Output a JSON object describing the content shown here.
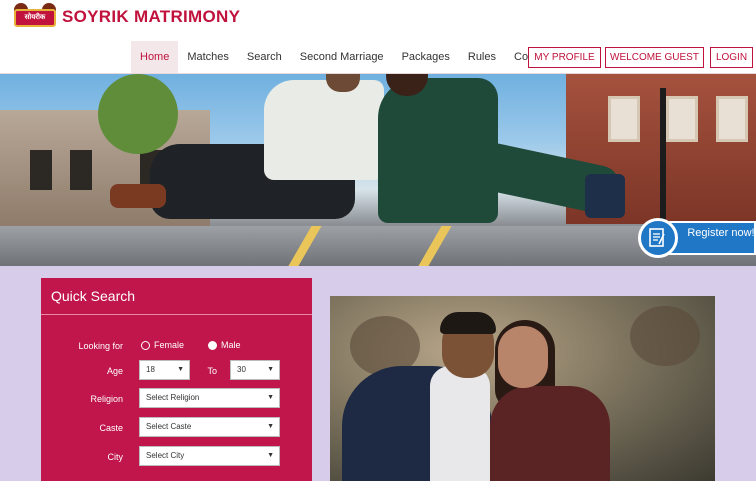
{
  "brand": {
    "name": "SOYRIK MATRIMONY",
    "emblem_text": "सोयरीक"
  },
  "nav": {
    "items": [
      {
        "label": "Home",
        "active": true
      },
      {
        "label": "Matches"
      },
      {
        "label": "Search"
      },
      {
        "label": "Second Marriage"
      },
      {
        "label": "Packages"
      },
      {
        "label": "Rules"
      },
      {
        "label": "Contact"
      }
    ],
    "my_profile": "MY PROFILE",
    "welcome": "WELCOME GUEST",
    "login": "LOGIN"
  },
  "banner": {
    "register_label": "Register now!"
  },
  "quick_search": {
    "title": "Quick Search",
    "looking_for_label": "Looking for",
    "female_label": "Female",
    "male_label": "Male",
    "selected_gender": "Male",
    "age_label": "Age",
    "age_from": "18",
    "to_label": "To",
    "age_to": "30",
    "religion_label": "Religion",
    "religion_value": "Select Religion",
    "caste_label": "Caste",
    "caste_value": "Select Caste",
    "city_label": "City",
    "city_value": "Select City"
  },
  "colors": {
    "brand": "#c0123c",
    "quick_search_bg": "#c0164b",
    "content_bg": "#d7cdea",
    "register_blue": "#1f77c6"
  },
  "icons": {
    "register": "form-document-icon",
    "dropdown": "caret-down-icon"
  }
}
